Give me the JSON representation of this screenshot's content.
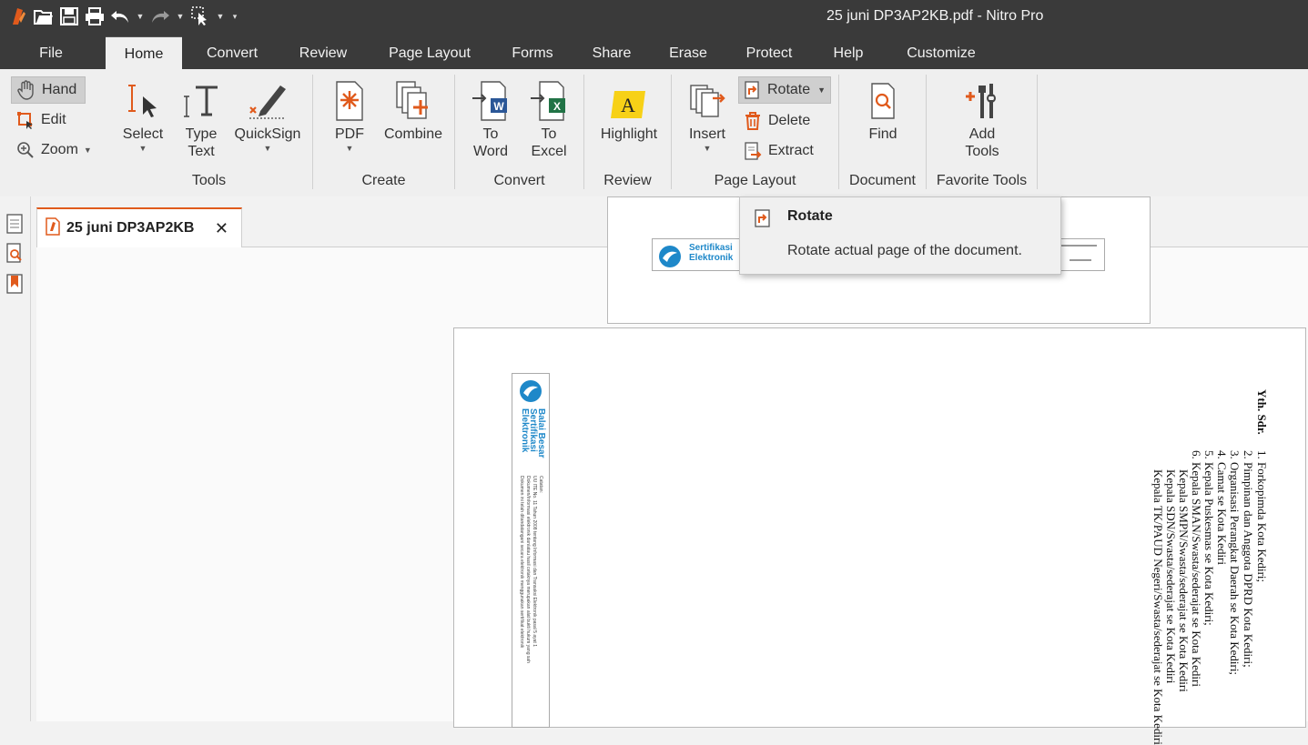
{
  "window": {
    "title": "25 juni DP3AP2KB.pdf - Nitro Pro"
  },
  "quick_access": [
    "app-logo-icon",
    "open-icon",
    "save-icon",
    "print-icon",
    "undo-icon",
    "redo-icon",
    "select-cursor-icon",
    "customize-qat-icon"
  ],
  "menu_tabs": [
    {
      "label": "File"
    },
    {
      "label": "Home"
    },
    {
      "label": "Convert"
    },
    {
      "label": "Review"
    },
    {
      "label": "Page Layout"
    },
    {
      "label": "Forms"
    },
    {
      "label": "Share"
    },
    {
      "label": "Erase"
    },
    {
      "label": "Protect"
    },
    {
      "label": "Help"
    },
    {
      "label": "Customize"
    }
  ],
  "ribbon": {
    "nav": {
      "hand": "Hand",
      "edit": "Edit",
      "zoom": "Zoom"
    },
    "tools": {
      "title": "Tools",
      "select": "Select",
      "type_text_1": "Type",
      "type_text_2": "Text",
      "quicksign": "QuickSign"
    },
    "create": {
      "title": "Create",
      "pdf": "PDF",
      "combine": "Combine"
    },
    "convert": {
      "title": "Convert",
      "to_word_1": "To",
      "to_word_2": "Word",
      "to_excel_1": "To",
      "to_excel_2": "Excel"
    },
    "review": {
      "title": "Review",
      "highlight": "Highlight"
    },
    "page_layout": {
      "title": "Page Layout",
      "insert": "Insert",
      "rotate": "Rotate",
      "delete": "Delete",
      "extract": "Extract"
    },
    "document": {
      "title": "Document",
      "find": "Find"
    },
    "favorite": {
      "title": "Favorite Tools",
      "add_1": "Add",
      "add_2": "Tools"
    }
  },
  "doc_tab": {
    "label": "25 juni DP3AP2KB",
    "close": "✕"
  },
  "tooltip": {
    "title": "Rotate",
    "description": "Rotate actual page of the document."
  },
  "document_content": {
    "stamp_top": {
      "line1": "Sertifikasi",
      "line2": "Elektronik"
    },
    "stamp_side": {
      "title": "Balai Besar Sertifikasi Elektronik",
      "lines": [
        "Catatan:",
        "UU ITE No. 11 Tahun 2008 tentang Informasi dan Transaksi Elektronik pasal 5 ayat 1",
        "Dokumen/Informasi elektronik dan/atau hasil cetaknya merupakan alat bukti hukum yang sah",
        "Dokumen ini telah ditandatangani secara elektronik menggunakan sertifikat elektronik"
      ]
    },
    "salutation": "Yth. Sdr.",
    "recipients": [
      "1.   Forkopimda Kota Kediri;",
      "2.   Pimpinan dan Anggota DPRD Kota Kediri;",
      "3.   Organisasi Perangkat Daerah se Kota Kediri;",
      "4.   Camat se Kota Kediri",
      "5.   Kepala Puskesmas se Kota Kediri;",
      "6.   Kepala SMAN/Swasta/sederajat se Kota Kediri",
      "Kepala SMPN/Swasta/sederajat se Kota Kediri",
      "Kepala SDN/Swasta/sederajat se Kota Kediri",
      "Kepala TK/PAUD Negeri/Swasta/sederajat se Kota Kediri"
    ]
  },
  "colors": {
    "accent": "#e05a1c",
    "titlebar": "#3a3a3a",
    "word_blue": "#2b5797",
    "excel_green": "#217346",
    "highlight_yellow": "#f7d117"
  }
}
